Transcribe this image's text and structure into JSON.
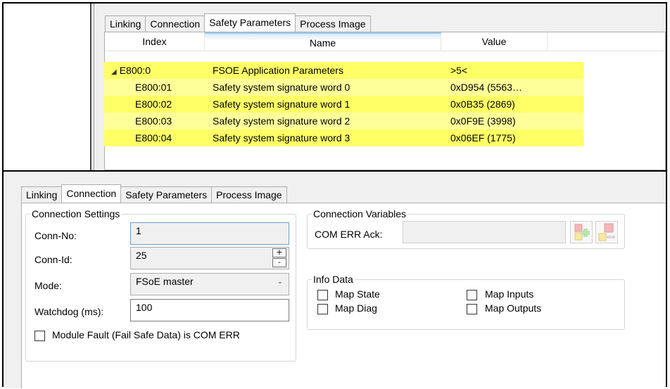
{
  "top_panel": {
    "tabs": [
      "Linking",
      "Connection",
      "Safety Parameters",
      "Process Image"
    ],
    "active_tab": 2,
    "columns": [
      "Index",
      "Name",
      "Value"
    ],
    "rows": [
      {
        "index": "E800:0",
        "name": "FSOE Application Parameters",
        "value": ">5<",
        "expanded": true
      },
      {
        "index": "E800:01",
        "name": "Safety system signature word 0",
        "value": "0xD954 (5563…"
      },
      {
        "index": "E800:02",
        "name": "Safety system signature word 1",
        "value": "0x0B35 (2869)"
      },
      {
        "index": "E800:03",
        "name": "Safety system signature word 2",
        "value": "0x0F9E (3998)"
      },
      {
        "index": "E800:04",
        "name": "Safety system signature word 3",
        "value": "0x06EF (1775)"
      }
    ],
    "row_colors": [
      "#ffff66",
      "#ffff99"
    ]
  },
  "bottom_panel": {
    "tabs": [
      "Linking",
      "Connection",
      "Safety Parameters",
      "Process Image"
    ],
    "active_tab": 1,
    "connection_settings": {
      "title": "Connection Settings",
      "conn_no_label": "Conn-No:",
      "conn_no_value": "1",
      "conn_id_label": "Conn-Id:",
      "conn_id_value": "25",
      "spin_up": "+",
      "spin_down": "-",
      "mode_label": "Mode:",
      "mode_value": "FSoE master",
      "watchdog_label": "Watchdog (ms):",
      "watchdog_value": "100",
      "module_fault_label": "Module Fault (Fail Safe Data) is COM ERR",
      "module_fault_checked": false
    },
    "connection_variables": {
      "title": "Connection Variables",
      "com_err_ack_label": "COM ERR Ack:",
      "com_err_ack_value": "",
      "add_icon": "link-variable-icon",
      "remove_icon": "unlink-variable-icon"
    },
    "info_data": {
      "title": "Info Data",
      "map_state": "Map State",
      "map_diag": "Map Diag",
      "map_inputs": "Map Inputs",
      "map_outputs": "Map Outputs"
    }
  }
}
